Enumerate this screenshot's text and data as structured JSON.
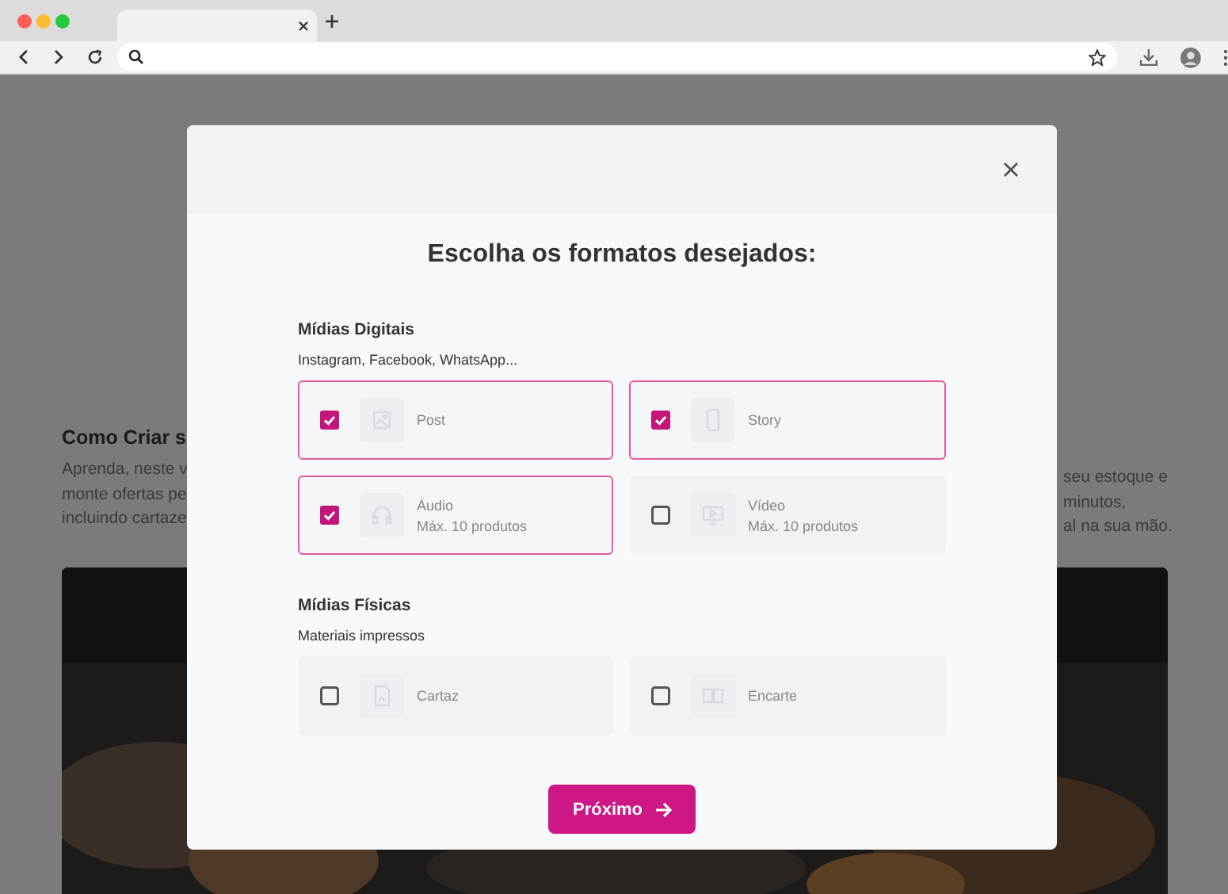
{
  "background_page": {
    "heading": "Como Criar s",
    "left_lines": [
      "Aprenda, neste v",
      "monte ofertas pe",
      "incluindo cartaze"
    ],
    "right_lines": [
      "seu estoque e",
      "minutos,",
      "al na sua mão."
    ]
  },
  "modal": {
    "title": "Escolha os formatos desejados:",
    "sections": [
      {
        "title": "Mídias Digitais",
        "subtitle": "Instagram, Facebook, WhatsApp...",
        "options": [
          {
            "label": "Post",
            "checked": true
          },
          {
            "label": "Story",
            "checked": true
          },
          {
            "label": "Áudio",
            "note": "Máx. 10 produtos",
            "checked": true
          },
          {
            "label": "Vídeo",
            "note": "Máx. 10 produtos",
            "checked": false
          }
        ]
      },
      {
        "title": "Mídias Físicas",
        "subtitle": "Materiais impressos",
        "options": [
          {
            "label": "Cartaz",
            "checked": false
          },
          {
            "label": "Encarte",
            "checked": false
          }
        ]
      }
    ],
    "button": {
      "label": "Próximo"
    }
  }
}
